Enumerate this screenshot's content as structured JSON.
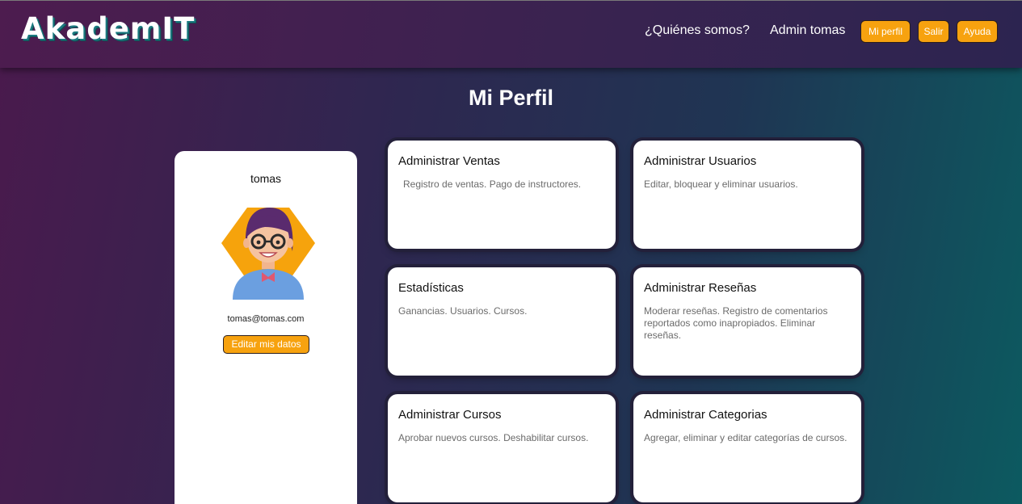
{
  "navbar": {
    "logo": "AkademIT",
    "links": {
      "quienes": "¿Quiénes somos?",
      "admin": "Admin tomas"
    },
    "buttons": {
      "perfil": "Mi perfil",
      "salir": "Salir",
      "ayuda": "Ayuda"
    }
  },
  "page": {
    "title": "Mi Perfil"
  },
  "profile": {
    "name": "tomas",
    "email": "tomas@tomas.com",
    "edit_label": "Editar mis datos",
    "avatar_icon": "woman-with-glasses-avatar-icon"
  },
  "cards": [
    {
      "title": "Administrar Ventas",
      "description": "Registro de ventas. Pago de instructores."
    },
    {
      "title": "Administrar Usuarios",
      "description": "Editar, bloquear y eliminar usuarios."
    },
    {
      "title": "Estadísticas",
      "description": "Ganancias. Usuarios. Cursos."
    },
    {
      "title": "Administrar Reseñas",
      "description": "Moderar reseñas. Registro de comentarios reportados como inapropiados. Eliminar reseñas."
    },
    {
      "title": "Administrar Cursos",
      "description": "Aprobar nuevos cursos. Deshabilitar cursos."
    },
    {
      "title": "Administrar Categorias",
      "description": "Agregar, eliminar y editar categorías de cursos."
    }
  ],
  "colors": {
    "accent": "#f7a20f",
    "navbar": "#3a2350",
    "card_background": "#ffffff"
  }
}
